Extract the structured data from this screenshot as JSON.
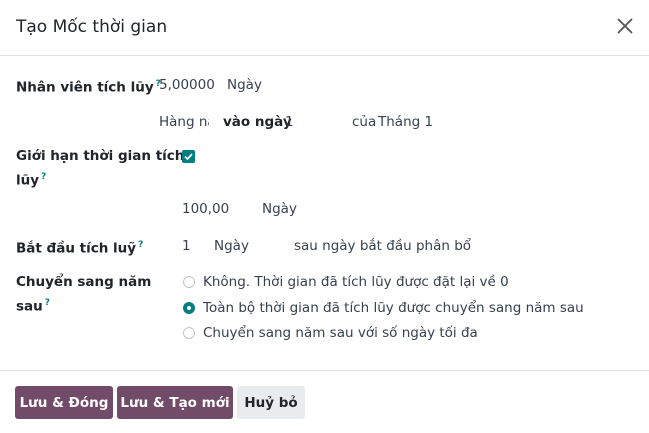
{
  "dialog": {
    "title": "Tạo Mốc thời gian",
    "close_icon": "close-icon"
  },
  "accrual": {
    "label": "Nhân viên tích lũy",
    "help": "?",
    "amount": "5,00000",
    "unit": "Ngày",
    "frequency": "Hàng nă",
    "on_day_label": "vào ngày",
    "day": "1",
    "of_month_label": "của",
    "month": "Tháng 1"
  },
  "cap": {
    "label_line1": "Giới hạn thời gian tích",
    "label_line2": "lũy",
    "help": "?",
    "checked": true,
    "max_amount": "100,00",
    "unit": "Ngày"
  },
  "start": {
    "label": "Bắt đầu tích luỹ",
    "help": "?",
    "count": "1",
    "unit": "Ngày",
    "after_text": "sau ngày bắt đầu phân bổ"
  },
  "carryover": {
    "label_line1": "Chuyển sang năm",
    "label_line2": "sau",
    "help": "?",
    "options": [
      {
        "label": "Không. Thời gian đã tích lũy được đặt lại về 0",
        "selected": false
      },
      {
        "label": "Toàn bộ thời gian đã tích lũy được chuyển sang năm sau",
        "selected": true
      },
      {
        "label": "Chuyển sang năm sau với số ngày tối đa",
        "selected": false
      }
    ]
  },
  "footer": {
    "save_close": "Lưu & Đóng",
    "save_new": "Lưu & Tạo mới",
    "discard": "Huỷ bỏ"
  },
  "colors": {
    "accent": "#017e84",
    "primary_button": "#714b67",
    "secondary_button": "#e9ecef"
  }
}
